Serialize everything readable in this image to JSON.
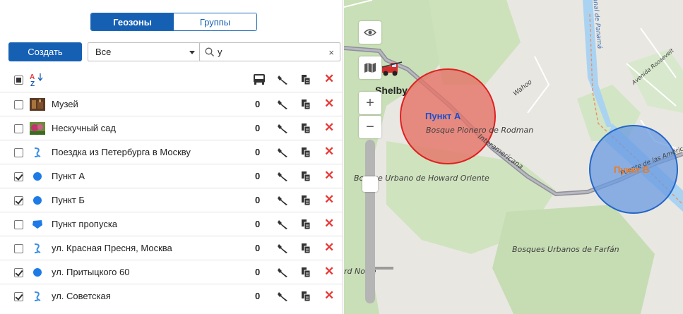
{
  "tabs": {
    "geozones": "Геозоны",
    "groups": "Группы"
  },
  "toolbar": {
    "create_label": "Создать",
    "filter_value": "Все",
    "search_value": "у",
    "clear_label": "×"
  },
  "header": {
    "sort_label": "A↓Z"
  },
  "rows": [
    {
      "name": "Музей",
      "count": "0",
      "checked": false,
      "icon": "museum-thumbnail"
    },
    {
      "name": "Нескучный сад",
      "count": "0",
      "checked": false,
      "icon": "garden-thumbnail"
    },
    {
      "name": "Поездка из Петербурга в Москву",
      "count": "0",
      "checked": false,
      "icon": "route-icon"
    },
    {
      "name": "Пункт А",
      "count": "0",
      "checked": true,
      "icon": "circle-icon"
    },
    {
      "name": "Пункт Б",
      "count": "0",
      "checked": true,
      "icon": "circle-icon"
    },
    {
      "name": "Пункт пропуска",
      "count": "0",
      "checked": false,
      "icon": "polygon-icon"
    },
    {
      "name": "ул. Красная Пресня, Москва",
      "count": "0",
      "checked": false,
      "icon": "route-icon"
    },
    {
      "name": "ул. Притыцкого 60",
      "count": "0",
      "checked": true,
      "icon": "circle-icon"
    },
    {
      "name": "ул. Советская",
      "count": "0",
      "checked": true,
      "icon": "route-icon"
    }
  ],
  "map": {
    "zoom_in": "+",
    "zoom_out": "−",
    "labels": {
      "shelby": "Shelby",
      "bosque_pionero": "Bosque Pionero de Rodman",
      "bosque_urbano": "Bosque Urbano de Howard Oriente",
      "bosques_farfan": "Bosques Urbanos de Farfán",
      "interamericana": "Interamericana",
      "wahoo": "Wahoo",
      "canal": "anal de Panamá",
      "avenida": "Avenida Roosevelt",
      "rd_norte": "rd Norte",
      "pan_americana": "Puente de las Américas"
    },
    "geozones": {
      "a": "Пункт А",
      "b": "Пункт Б"
    }
  },
  "colors": {
    "accent": "#1660b4",
    "delete": "#e53935",
    "zone_a_fill": "#e57368",
    "zone_a_stroke": "#e02020",
    "zone_b_fill": "#6a9be0",
    "zone_b_stroke": "#2466c8",
    "zone_a_label": "#1a4fd0",
    "zone_b_label": "#f07a1c"
  }
}
